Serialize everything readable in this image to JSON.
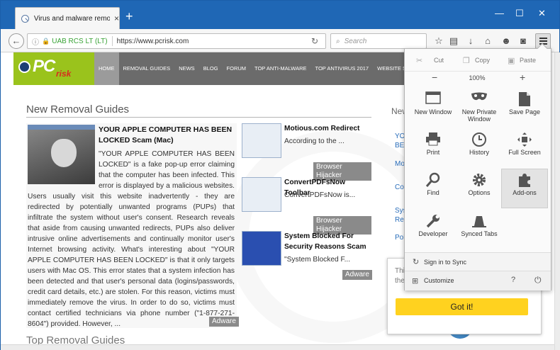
{
  "browser": {
    "tab_title": "Virus and malware remov...",
    "tab_close": "×",
    "new_tab": "+",
    "window_controls": {
      "minimize": "—",
      "maximize": "☐",
      "close": "✕"
    },
    "back": "←",
    "url_org": "UAB RCS LT (LT)",
    "url": "https://www.pcrisk.com",
    "search_placeholder": "Search"
  },
  "site": {
    "logo_pc": "PC",
    "logo_risk": "risk",
    "nav": [
      "HOME",
      "REMOVAL GUIDES",
      "NEWS",
      "BLOG",
      "FORUM",
      "TOP ANTI-MALWARE",
      "TOP ANTIVIRUS 2017",
      "WEBSITE SCANNER"
    ],
    "section_title": "New Removal Guides",
    "featured": {
      "title": "YOUR APPLE COMPUTER HAS BEEN LOCKED Scam (Mac)",
      "text": "\"YOUR APPLE COMPUTER HAS BEEN LOCKED\" is a fake pop-up error claiming that the computer has been infected. This error is displayed by a malicious websites. Users usually visit this website inadvertently - they are redirected by potentially unwanted programs (PUPs) that infiltrate the system without user's consent. Research reveals that aside from causing unwanted redirects, PUPs also deliver intrusive online advertisements and continually monitor user's Internet browsing activity. What's interesting about \"YOUR APPLE COMPUTER HAS BEEN LOCKED\" is that it only targets users with Mac OS. This error states that a system infection has been detected and that user's personal data (logins/passwords, credit card details, etc.) are stolen. For this reason, victims must immediately remove the virus. In order to do so, victims must contact certified technicians via phone number (\"1-877-271-8604\") provided. However, ...",
      "tag": "Adware"
    },
    "items": [
      {
        "title": "Motious.com Redirect",
        "excerpt": "According to the ...",
        "tag": "Browser Hijacker"
      },
      {
        "title": "ConvertPDFsNow Toolbar",
        "excerpt": "ConvertPDFsNow is...",
        "tag": "Browser Hijacker"
      },
      {
        "title": "System Blocked For Security Reasons Scam",
        "excerpt": "\"System Blocked F...",
        "tag": "Adware"
      }
    ],
    "sidebar_heading": "New",
    "sidebar_links": [
      "YOU",
      "BEE",
      "Mo",
      "Cor",
      "Sys",
      "Rea",
      "Pol"
    ],
    "section_title_2": "Top Removal Guides"
  },
  "notification": {
    "line1": "Thi",
    "line2": "the",
    "button": "Got it!"
  },
  "menu_panel": {
    "cut": "Cut",
    "copy": "Copy",
    "paste": "Paste",
    "zoom_out": "−",
    "zoom_level": "100%",
    "zoom_in": "+",
    "items": [
      {
        "label": "New Window",
        "icon": "new-window-icon"
      },
      {
        "label": "New Private Window",
        "icon": "private-mask-icon"
      },
      {
        "label": "Save Page",
        "icon": "save-page-icon"
      },
      {
        "label": "Print",
        "icon": "print-icon"
      },
      {
        "label": "History",
        "icon": "history-clock-icon"
      },
      {
        "label": "Full Screen",
        "icon": "full-screen-icon"
      },
      {
        "label": "Find",
        "icon": "find-icon"
      },
      {
        "label": "Options",
        "icon": "options-gear-icon"
      },
      {
        "label": "Add-ons",
        "icon": "addons-puzzle-icon"
      },
      {
        "label": "Developer",
        "icon": "developer-wrench-icon"
      },
      {
        "label": "Synced Tabs",
        "icon": "synced-tabs-icon"
      }
    ],
    "sign_in": "Sign in to Sync",
    "customize": "Customize"
  }
}
